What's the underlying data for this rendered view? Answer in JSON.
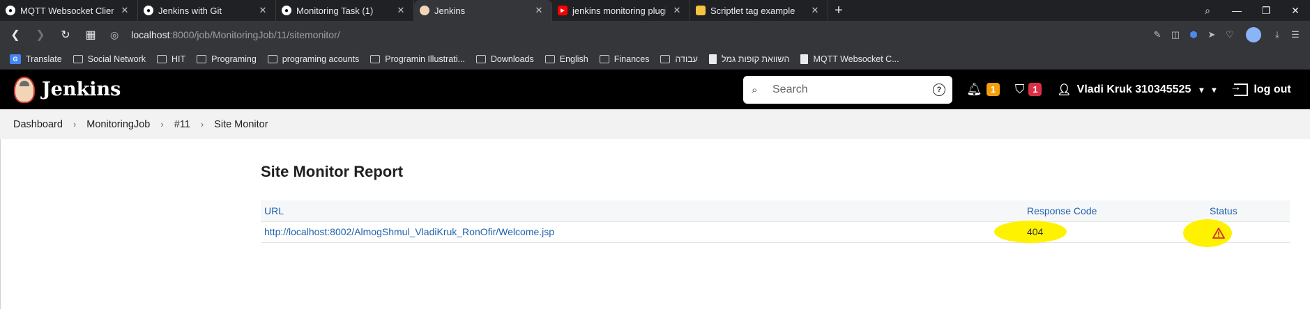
{
  "browser": {
    "tabs": [
      {
        "label": "MQTT Websocket Client",
        "icon": "github-icon",
        "active": false
      },
      {
        "label": "Jenkins with Git",
        "icon": "github-icon",
        "active": false
      },
      {
        "label": "Monitoring Task (1)",
        "icon": "github-icon",
        "active": false
      },
      {
        "label": "Jenkins",
        "icon": "jenkins-icon",
        "active": true
      },
      {
        "label": "jenkins monitoring plugin -",
        "icon": "youtube-icon",
        "active": false
      },
      {
        "label": "Scriptlet tag example",
        "icon": "page-icon",
        "active": false
      }
    ],
    "address": {
      "host": "localhost",
      "path": ":8000/job/MonitoringJob/11/sitemonitor/"
    },
    "bookmarks": [
      {
        "label": "Translate",
        "icon": "google-translate-icon"
      },
      {
        "label": "Social Network",
        "icon": "folder-icon"
      },
      {
        "label": "HIT",
        "icon": "folder-icon"
      },
      {
        "label": "Programing",
        "icon": "folder-icon"
      },
      {
        "label": "programing acounts",
        "icon": "folder-icon"
      },
      {
        "label": "Programin Illustrati...",
        "icon": "folder-icon"
      },
      {
        "label": "Downloads",
        "icon": "folder-icon"
      },
      {
        "label": "English",
        "icon": "folder-icon"
      },
      {
        "label": "Finances",
        "icon": "folder-icon"
      },
      {
        "label": "עבודה",
        "icon": "folder-icon"
      },
      {
        "label": "השוואת קופות גמל",
        "icon": "page-icon"
      },
      {
        "label": "MQTT Websocket C...",
        "icon": "page-icon"
      }
    ]
  },
  "jenkins": {
    "brand": "Jenkins",
    "search_placeholder": "Search",
    "notifications_count": "1",
    "security_count": "1",
    "user_name": "Vladi Kruk 310345525",
    "logout_label": "log out"
  },
  "breadcrumb": [
    "Dashboard",
    "MonitoringJob",
    "#11",
    "Site Monitor"
  ],
  "report": {
    "title": "Site Monitor Report",
    "headers": {
      "url": "URL",
      "code": "Response Code",
      "status": "Status"
    },
    "rows": [
      {
        "url": "http://localhost:8002/AlmogShmul_VladiKruk_RonOfir/Welcome.jsp",
        "code": "404",
        "status_icon": "warning-icon"
      }
    ]
  },
  "colors": {
    "header_bg": "#000000",
    "link": "#1f62ad",
    "highlight": "#fff200",
    "warning": "#d32f2f"
  }
}
